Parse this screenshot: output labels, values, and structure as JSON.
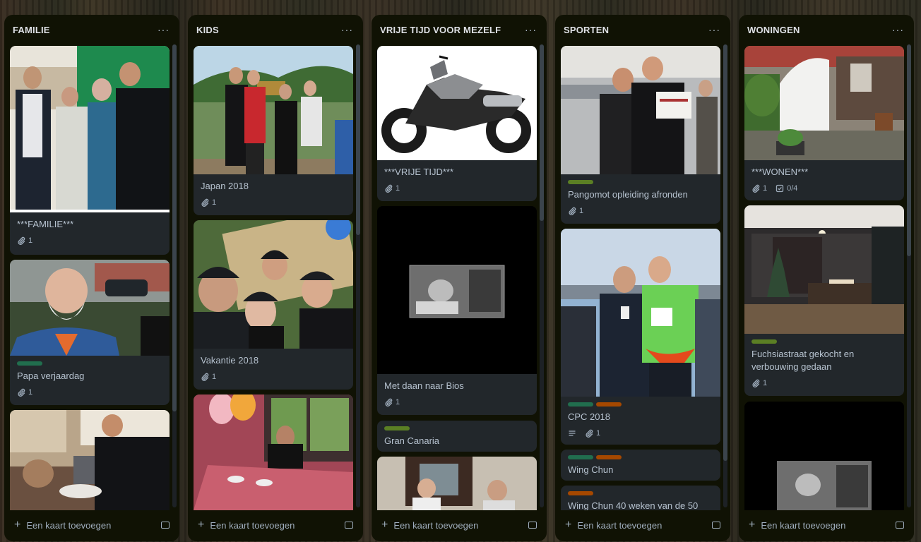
{
  "colors": {
    "green": "#216e4e",
    "lime": "#5b7f24",
    "orange": "#a54800",
    "list_bg": "#101204",
    "card_bg": "#22272b"
  },
  "icons": {
    "attachment": "paperclip-icon",
    "checklist": "checklist-icon",
    "description": "description-icon",
    "more": "more-icon",
    "add": "plus-icon",
    "template": "template-icon"
  },
  "lists": [
    {
      "title": "FAMILIE",
      "add": "Een kaart toevoegen",
      "cards": [
        {
          "title": "***FAMILIE***",
          "attachments": "1"
        },
        {
          "title": "Papa verjaardag",
          "attachments": "1"
        }
      ]
    },
    {
      "title": "KIDS",
      "add": "Een kaart toevoegen",
      "cards": [
        {
          "title": "Japan 2018",
          "attachments": "1"
        },
        {
          "title": "Vakantie 2018",
          "attachments": "1"
        }
      ]
    },
    {
      "title": "VRIJE TIJD VOOR MEZELF",
      "add": "Een kaart toevoegen",
      "cards": [
        {
          "title": "***VRIJE TIJD***",
          "attachments": "1"
        },
        {
          "title": "Met daan naar Bios",
          "attachments": "1"
        },
        {
          "title": "Gran Canaria"
        }
      ]
    },
    {
      "title": "SPORTEN",
      "add": "Een kaart toevoegen",
      "cards": [
        {
          "title": "Pangomot opleiding afronden",
          "attachments": "1"
        },
        {
          "title": "CPC 2018",
          "attachments": "1"
        },
        {
          "title": "Wing Chun"
        },
        {
          "title": "Wing Chun 40 weken van de 50"
        }
      ]
    },
    {
      "title": "WONINGEN",
      "add": "Een kaart toevoegen",
      "cards": [
        {
          "title": "***WONEN***",
          "attachments": "1",
          "checklist": "0/4"
        },
        {
          "title": "Fuchsiastraat gekocht en verbouwing gedaan",
          "attachments": "1"
        }
      ]
    }
  ]
}
